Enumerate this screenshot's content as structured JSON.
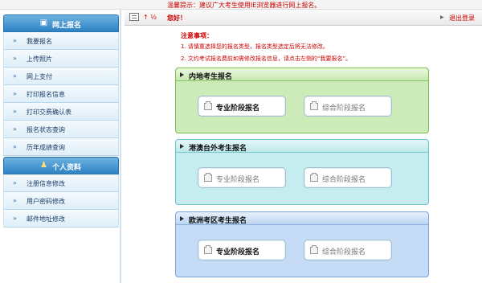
{
  "top_tip": "温馨提示：建议广大考生使用IE浏览器进行网上报名。",
  "header": {
    "greeting_prefix": "↑ ½",
    "greeting": "您好！",
    "logout_label": "退出登录"
  },
  "sidebar": {
    "section1_title": "网上报名",
    "section1_items": [
      {
        "label": "我要报名"
      },
      {
        "label": "上传照片"
      },
      {
        "label": "网上支付"
      },
      {
        "label": "打印报名信息"
      },
      {
        "label": "打印交费确认表"
      },
      {
        "label": "报名状态查询"
      },
      {
        "label": "历年成绩查询"
      }
    ],
    "section2_title": "个人资料",
    "section2_items": [
      {
        "label": "注册信息修改"
      },
      {
        "label": "用户密码修改"
      },
      {
        "label": "邮件地址修改"
      }
    ]
  },
  "notice": {
    "title": "注意事项：",
    "lines": [
      "1. 请慎重选择您的报名类型，报名类型选定后将无法修改。",
      "2. 文约考试报名费前如需修改报名信息，请点击左侧的“我要报名”。"
    ]
  },
  "panels": [
    {
      "title": "内地考生报名",
      "btn1": "专业阶段报名",
      "btn2": "综合阶段报名",
      "active": [
        true,
        false
      ]
    },
    {
      "title": "港澳台外考生报名",
      "btn1": "专业阶段报名",
      "btn2": "综合阶段报名",
      "active": [
        false,
        false
      ]
    },
    {
      "title": "欧洲考区考生报名",
      "btn1": "专业阶段报名",
      "btn2": "综合阶段报名",
      "active": [
        true,
        false
      ]
    }
  ],
  "colors": {
    "accent_red": "#cc0000",
    "sidebar_header": "#2d82c4",
    "panel_green": "#ccebb8",
    "panel_cyan": "#c5ecee",
    "panel_blue": "#c6dcf6"
  }
}
